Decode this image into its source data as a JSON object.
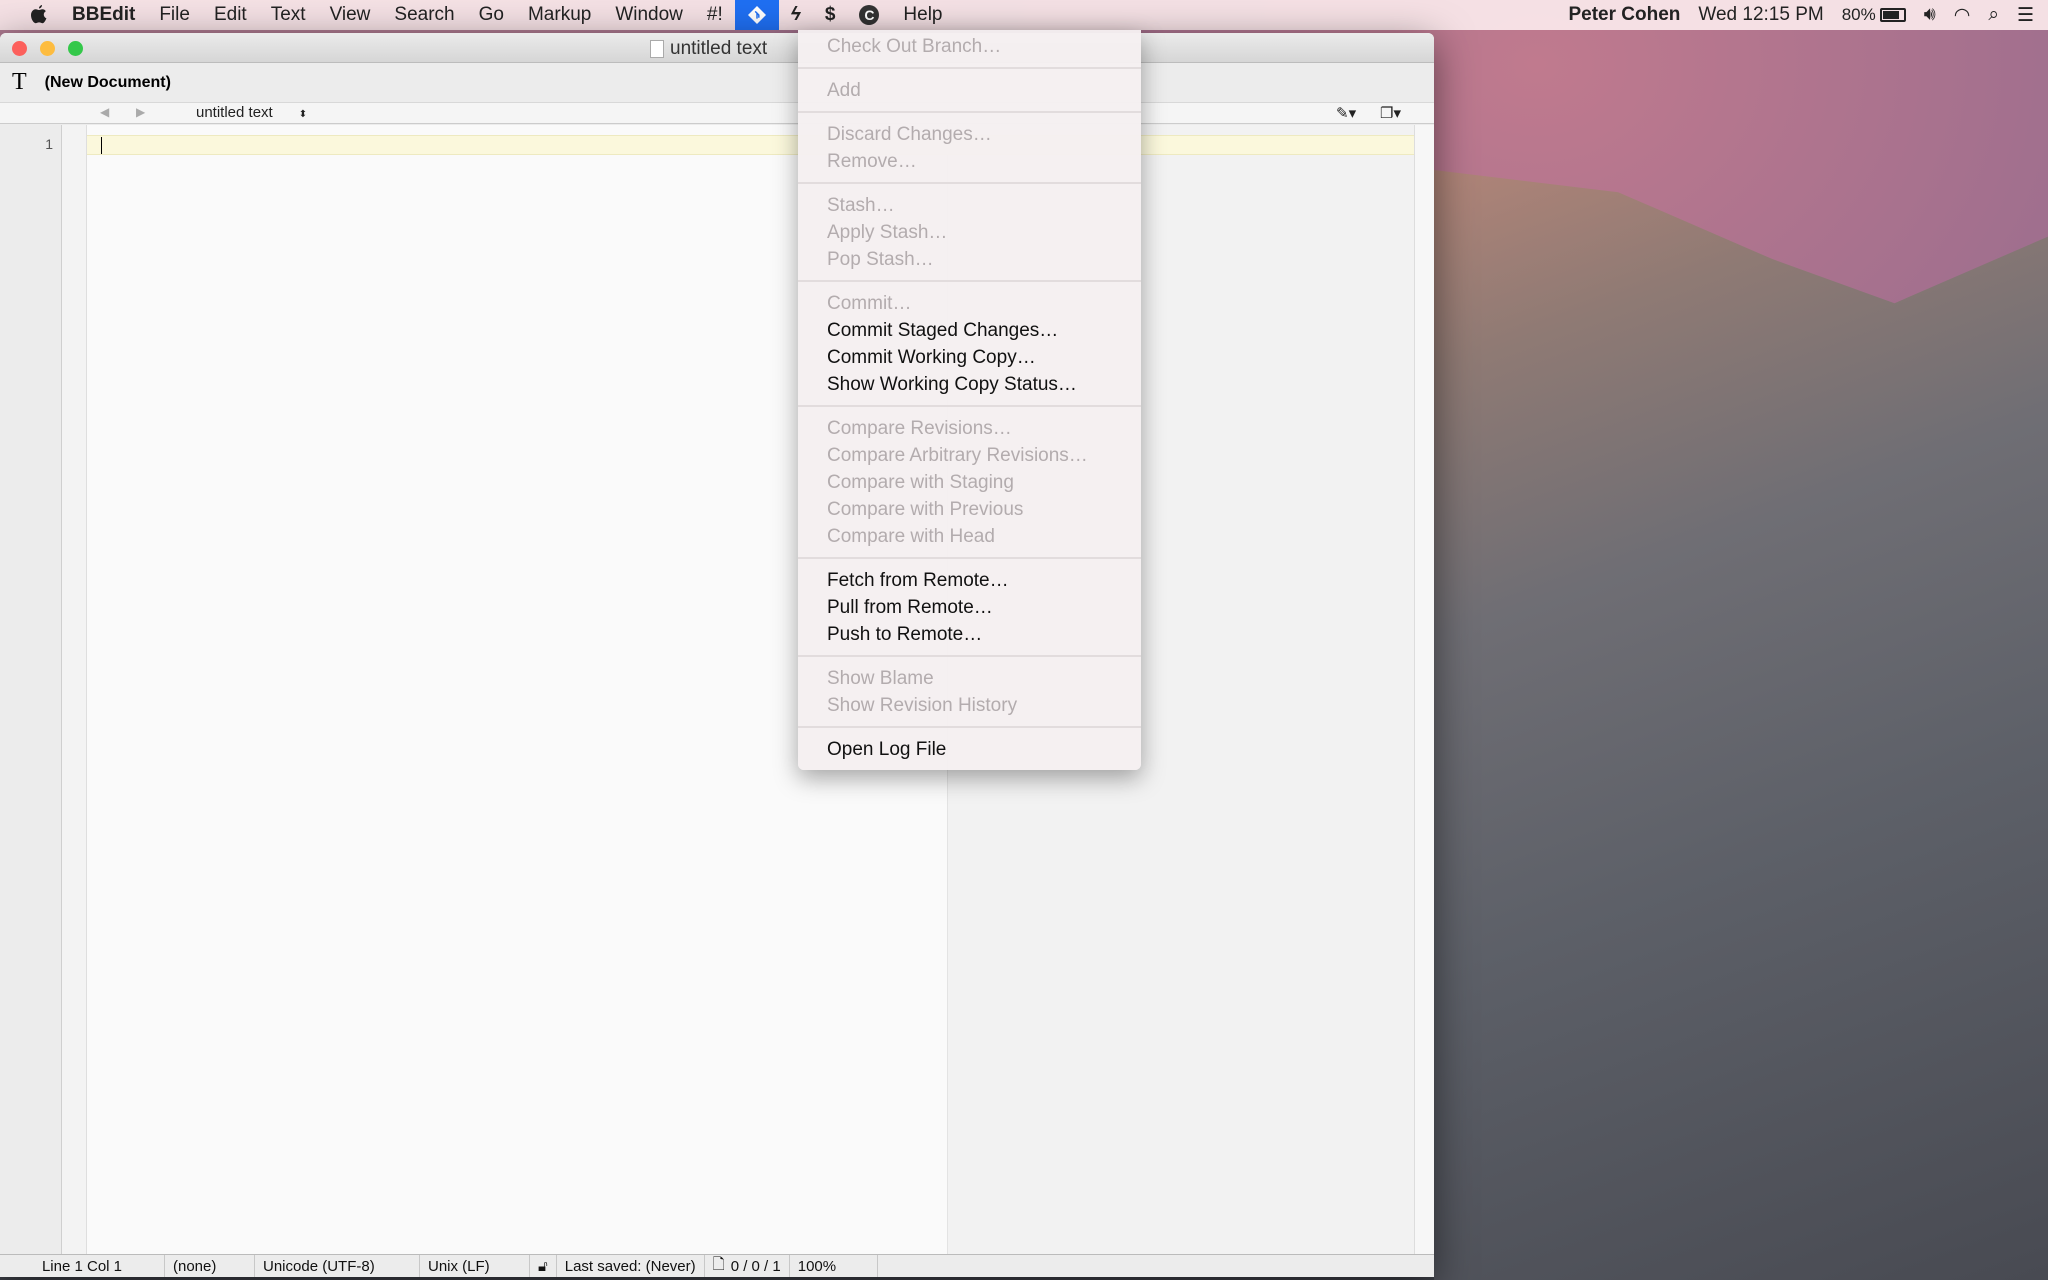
{
  "menubar": {
    "app": "BBEdit",
    "items": [
      "File",
      "Edit",
      "Text",
      "View",
      "Search",
      "Go",
      "Markup",
      "Window",
      "#!"
    ],
    "extra_icons": [
      "git-icon",
      "script-s-icon",
      "script-bolt-icon",
      "copyright-c-icon"
    ],
    "help": "Help",
    "user": "Peter Cohen",
    "clock": "Wed 12:15 PM",
    "battery": "80%"
  },
  "window": {
    "title": "untitled text",
    "toolbar_title": "(New Document)",
    "nav_document": "untitled text",
    "line_number": "1"
  },
  "status": {
    "position": "Line 1 Col 1",
    "language": "(none)",
    "encoding": "Unicode (UTF-8)",
    "line_endings": "Unix (LF)",
    "saved": "Last saved: (Never)",
    "counts": "0 / 0 / 1",
    "zoom": "100%"
  },
  "git_menu": [
    [
      {
        "label": "Check Out Branch…",
        "enabled": false
      }
    ],
    [
      {
        "label": "Add",
        "enabled": false
      }
    ],
    [
      {
        "label": "Discard Changes…",
        "enabled": false
      },
      {
        "label": "Remove…",
        "enabled": false
      }
    ],
    [
      {
        "label": "Stash…",
        "enabled": false
      },
      {
        "label": "Apply Stash…",
        "enabled": false
      },
      {
        "label": "Pop Stash…",
        "enabled": false
      }
    ],
    [
      {
        "label": "Commit…",
        "enabled": false
      },
      {
        "label": "Commit Staged Changes…",
        "enabled": true
      },
      {
        "label": "Commit Working Copy…",
        "enabled": true
      },
      {
        "label": "Show Working Copy Status…",
        "enabled": true
      }
    ],
    [
      {
        "label": "Compare Revisions…",
        "enabled": false
      },
      {
        "label": "Compare Arbitrary Revisions…",
        "enabled": false
      },
      {
        "label": "Compare with Staging",
        "enabled": false
      },
      {
        "label": "Compare with Previous",
        "enabled": false
      },
      {
        "label": "Compare with Head",
        "enabled": false
      }
    ],
    [
      {
        "label": "Fetch from Remote…",
        "enabled": true
      },
      {
        "label": "Pull from Remote…",
        "enabled": true
      },
      {
        "label": "Push to Remote…",
        "enabled": true
      }
    ],
    [
      {
        "label": "Show Blame",
        "enabled": false
      },
      {
        "label": "Show Revision History",
        "enabled": false
      }
    ],
    [
      {
        "label": "Open Log File",
        "enabled": true
      }
    ]
  ],
  "colors": {
    "menu_highlight": "#1f6ff2",
    "current_line": "#fbf8dc"
  }
}
